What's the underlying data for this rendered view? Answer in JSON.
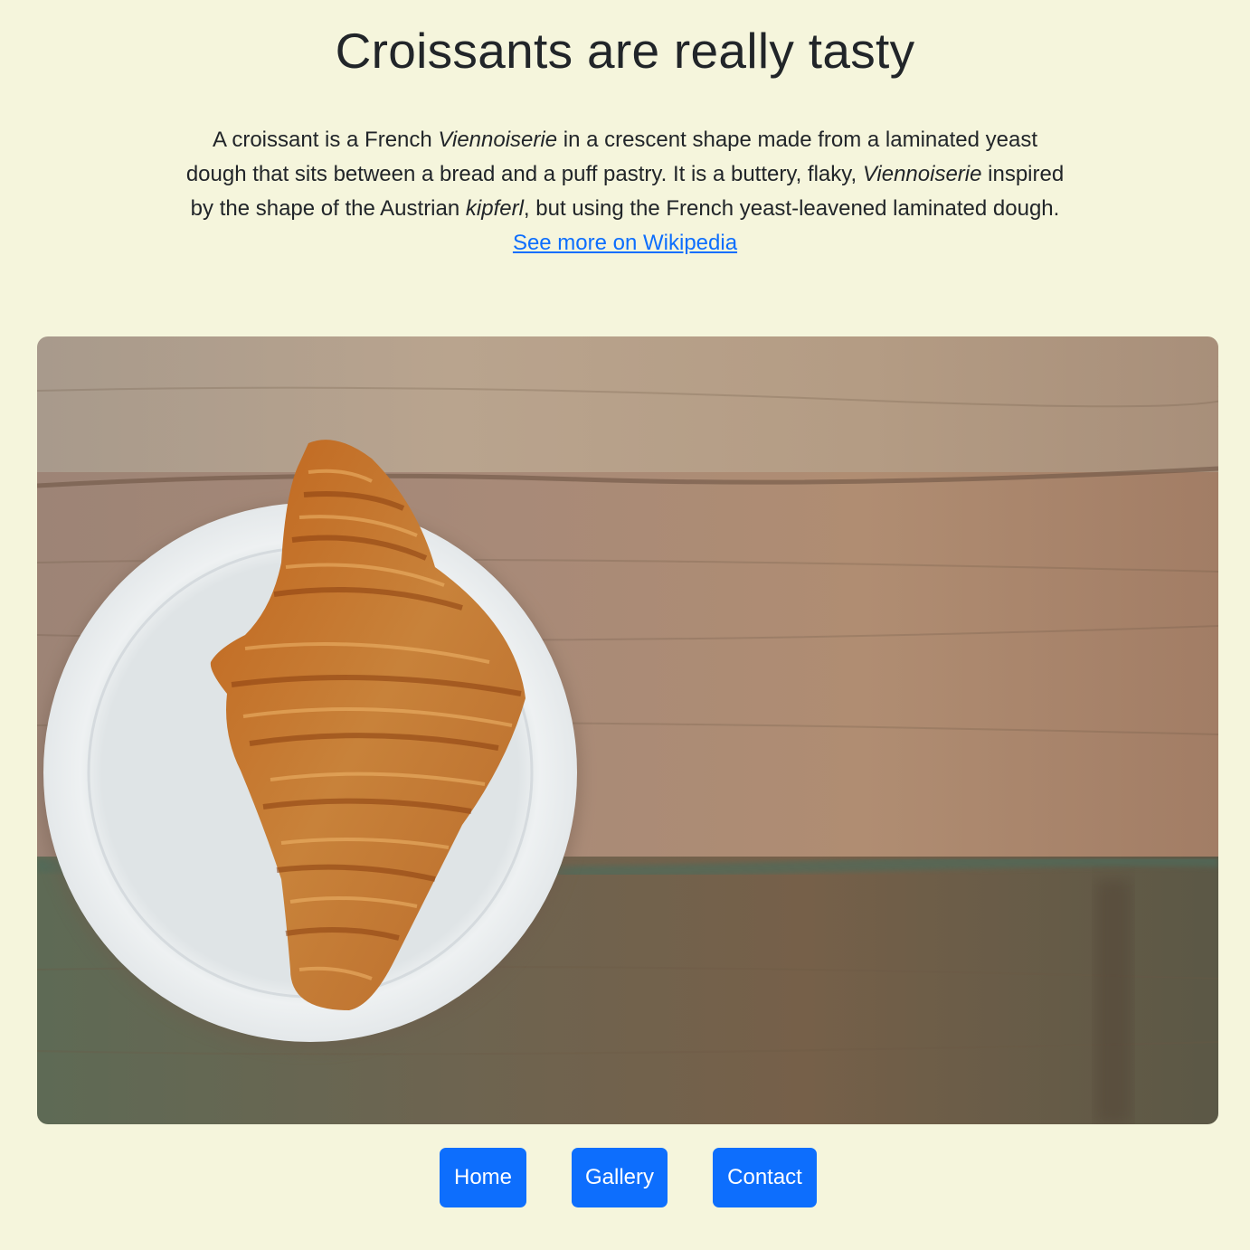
{
  "page": {
    "title": "Croissants are really tasty"
  },
  "intro": {
    "text_1": "A croissant is a French ",
    "em_1": "Viennoiserie",
    "text_2": " in a crescent shape made from a laminated yeast dough that sits between a bread and a puff pastry. It is a buttery, flaky, ",
    "em_2": "Viennoiserie",
    "text_3": " inspired by the shape of the Austrian ",
    "em_3": "kipferl",
    "text_4": ", but using the French yeast-leavened laminated dough.",
    "link_label": "See more on Wikipedia"
  },
  "nav": {
    "home_label": "Home",
    "gallery_label": "Gallery",
    "contact_label": "Contact"
  },
  "colors": {
    "background": "#f5f5dc",
    "button": "#0d6efd",
    "link": "#0d6efd",
    "text": "#212529"
  }
}
